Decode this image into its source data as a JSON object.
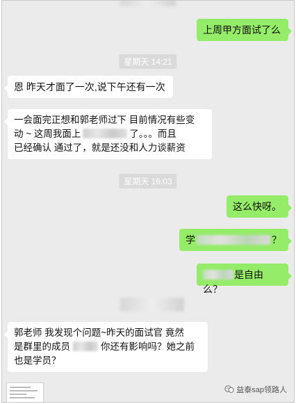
{
  "messages": {
    "m1": {
      "text": "上周甲方面试了么"
    },
    "m2": {
      "text": "恩 昨天才面了一次,说下午还有一次"
    },
    "m3": {
      "line1": "一会面完正想和郭老师过下  目前情况有些变",
      "line2a": "动   ~ 这周我面上",
      "line2b": "了。。。而且",
      "line3": "已经确认 通过了，就是还没和人力谈薪资"
    },
    "m4": {
      "text": "这么快呀。"
    },
    "m5": {
      "prefix": "学",
      "suffix": "？"
    },
    "m6": {
      "suffix": "是自由么？"
    },
    "m7": {
      "line1": "郭老师 我发现个问题~昨天的面试官  竟然",
      "line2a": "是群里的成员",
      "line2b": "你还有影响吗？她之前",
      "line3": "也是学员？"
    }
  },
  "times": {
    "t1": "星期天 14:21",
    "t2": "星期天 16:03"
  },
  "watermark": {
    "text": "益泰sap领路人",
    "icon": "wechat-official-account-icon"
  },
  "colors": {
    "background": "#ebebeb",
    "sent_bubble": "#95ec69",
    "received_bubble": "#ffffff",
    "time_pill": "#dadada"
  }
}
